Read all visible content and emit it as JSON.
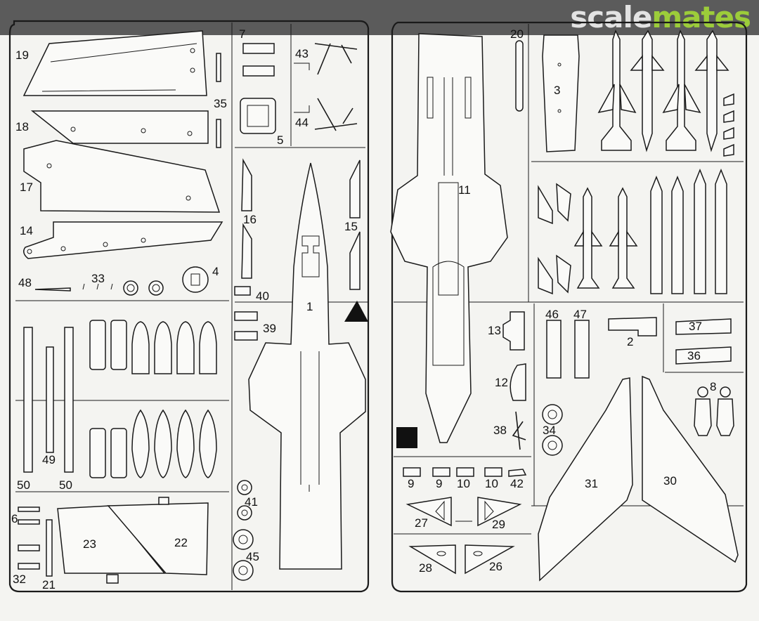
{
  "brand": {
    "part1": "scale",
    "part2": "mates",
    "color1": "#e3e3e3",
    "color2": "#9ccc3a"
  },
  "bar_color": "#5b5b5b",
  "parts": {
    "p1": "1",
    "p2": "2",
    "p3": "3",
    "p4": "4",
    "p5": "5",
    "p6": "6",
    "p7": "7",
    "p8": "8",
    "p9a": "9",
    "p9b": "9",
    "p10a": "10",
    "p10b": "10",
    "p11": "11",
    "p12": "12",
    "p13": "13",
    "p14": "14",
    "p15": "15",
    "p16": "16",
    "p17": "17",
    "p18": "18",
    "p19": "19",
    "p20": "20",
    "p21": "21",
    "p22": "22",
    "p23": "23",
    "p26": "26",
    "p27": "27",
    "p28": "28",
    "p29": "29",
    "p30": "30",
    "p31": "31",
    "p32": "32",
    "p33": "33",
    "p34": "34",
    "p35": "35",
    "p36": "36",
    "p37": "37",
    "p38": "38",
    "p39": "39",
    "p40": "40",
    "p41": "41",
    "p42": "42",
    "p43": "43",
    "p44": "44",
    "p45": "45",
    "p46": "46",
    "p47": "47",
    "p48": "48",
    "p49": "49",
    "p50a": "50",
    "p50b": "50"
  }
}
